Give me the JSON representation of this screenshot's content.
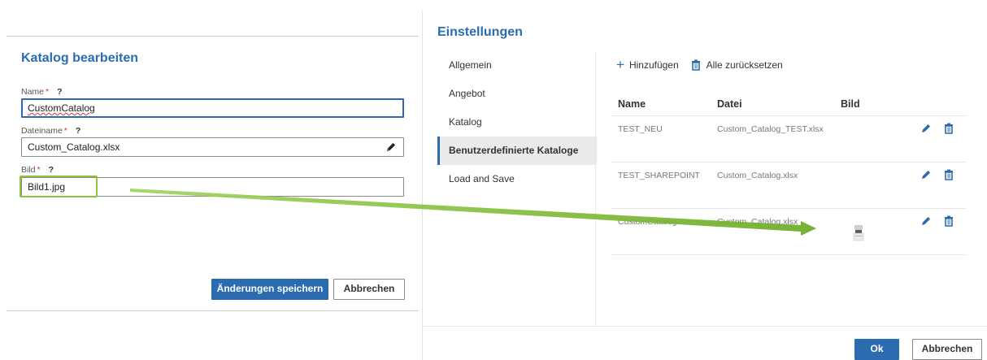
{
  "edit_panel": {
    "title": "Katalog bearbeiten",
    "name_label": "Name",
    "name_required": "*",
    "name_help": "?",
    "name_value": "CustomCatalog",
    "file_label": "Dateiname",
    "file_required": "*",
    "file_help": "?",
    "file_value": "Custom_Catalog.xlsx",
    "image_label": "Bild",
    "image_required": "*",
    "image_help": "?",
    "image_value": "Bild1.jpg",
    "save_button": "Änderungen speichern",
    "cancel_button": "Abbrechen"
  },
  "settings": {
    "title": "Einstellungen",
    "nav": [
      {
        "label": "Allgemein"
      },
      {
        "label": "Angebot"
      },
      {
        "label": "Katalog"
      },
      {
        "label": "Benutzerdefinierte Kataloge",
        "active": true
      },
      {
        "label": "Load and Save"
      }
    ],
    "toolbar": {
      "add_label": "Hinzufügen",
      "reset_label": "Alle zurücksetzen"
    },
    "table": {
      "headers": [
        "Name",
        "Datei",
        "Bild"
      ],
      "rows": [
        {
          "name": "TEST_NEU",
          "file": "Custom_Catalog_TEST.xlsx",
          "image": ""
        },
        {
          "name": "TEST_SHAREPOINT",
          "file": "Custom_Catalog.xlsx",
          "image": ""
        },
        {
          "name": "CustomCatalog",
          "file": "Custom_Catalog.xlsx",
          "image": "printer-thumbnail"
        }
      ]
    },
    "ok_button": "Ok",
    "cancel_button": "Abbrechen"
  },
  "colors": {
    "accent": "#2b6cb0",
    "required": "#d13438",
    "annotation": "#8cc43c"
  }
}
